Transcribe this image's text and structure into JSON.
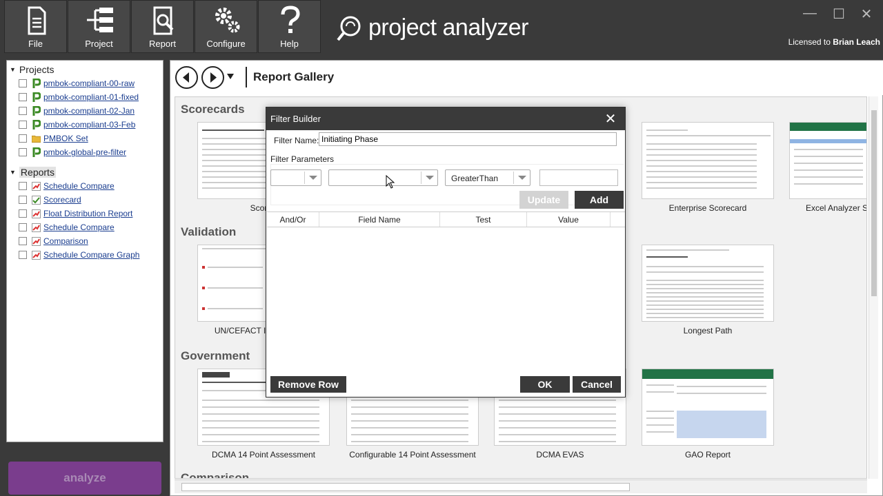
{
  "toolbar": {
    "buttons": [
      {
        "label": "File",
        "icon": "file-icon"
      },
      {
        "label": "Project",
        "icon": "project-tree-icon"
      },
      {
        "label": "Report",
        "icon": "report-icon"
      },
      {
        "label": "Configure",
        "icon": "gears-icon"
      },
      {
        "label": "Help",
        "icon": "question-icon"
      }
    ],
    "brand": "project analyzer",
    "licensed_label": "Licensed to",
    "licensed_user": "Brian Leach"
  },
  "window_controls": {
    "minimize": "—",
    "maximize": "☐",
    "close": "✕"
  },
  "tree": {
    "projects_label": "Projects",
    "projects": [
      {
        "label": "pmbok-compliant-00-raw",
        "icon": "project-p-icon"
      },
      {
        "label": "pmbok-compliant-01-fixed",
        "icon": "project-p-icon"
      },
      {
        "label": "pmbok-compliant-02-Jan",
        "icon": "project-p-icon"
      },
      {
        "label": "pmbok-compliant-03-Feb",
        "icon": "project-p-icon"
      },
      {
        "label": "PMBOK Set",
        "icon": "folder-icon"
      },
      {
        "label": "pmbok-global-pre-filter",
        "icon": "project-p-icon"
      }
    ],
    "reports_label": "Reports",
    "reports": [
      {
        "label": "Schedule Compare",
        "icon": "report-chart-icon"
      },
      {
        "label": "Scorecard",
        "icon": "scorecard-icon"
      },
      {
        "label": "Float Distribution Report",
        "icon": "report-chart-icon"
      },
      {
        "label": "Schedule Compare",
        "icon": "report-chart-icon"
      },
      {
        "label": "Comparison",
        "icon": "report-chart-icon"
      },
      {
        "label": "Schedule Compare Graph",
        "icon": "report-chart-icon"
      }
    ]
  },
  "analyze_label": "analyze",
  "gallery": {
    "title": "Report Gallery",
    "sections": {
      "scorecards": "Scorecards",
      "validation": "Validation",
      "government": "Government",
      "comparison": "Comparison"
    },
    "captions": {
      "scorecard_partial": "Score",
      "enterprise_scorecard": "Enterprise Scorecard",
      "excel_analyzer_partial": "Excel Analyzer S",
      "uncefact_partial": "UN/CEFACT IN",
      "longest_path": "Longest Path",
      "dcma14": "DCMA 14 Point Assessment",
      "configurable14": "Configurable 14 Point Assessment",
      "dcma_evas": "DCMA EVAS",
      "gao_report": "GAO Report"
    }
  },
  "dialog": {
    "title": "Filter Builder",
    "filter_name_label": "Filter Name:",
    "filter_name_value": "Initiating Phase",
    "filter_parameters_label": "Filter Parameters",
    "and_or_value": "",
    "field_value": "",
    "test_value": "GreaterThan",
    "value_value": "",
    "update_label": "Update",
    "add_label": "Add",
    "columns": [
      "And/Or",
      "Field Name",
      "Test",
      "Value"
    ],
    "remove_row_label": "Remove Row",
    "ok_label": "OK",
    "cancel_label": "Cancel"
  },
  "colors": {
    "chrome": "#3a3a3a",
    "analyze": "#7a3d8d",
    "link": "#1a3d8f",
    "project_icon": "#3b8a24"
  }
}
